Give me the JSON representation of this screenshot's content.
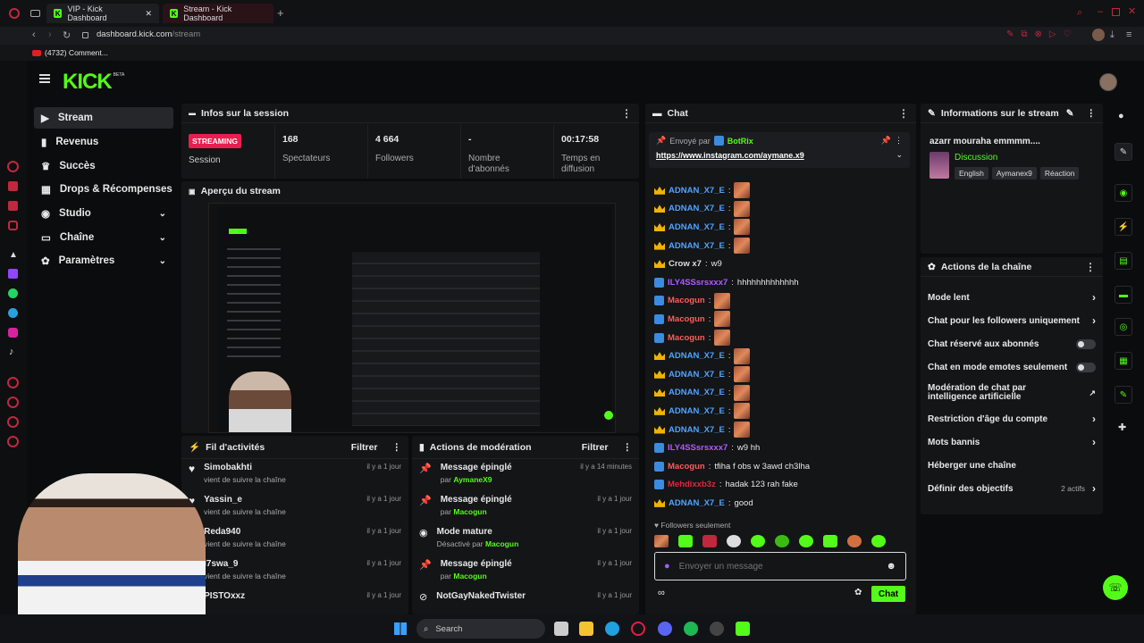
{
  "browser": {
    "tabs": [
      {
        "title": "VIP - Kick Dashboard"
      },
      {
        "title": "Stream - Kick Dashboard"
      }
    ],
    "url_host": "dashboard.kick.com",
    "url_path": "/stream",
    "bookmark": "(4732) Comment...",
    "search_placeholder": "Search"
  },
  "header": {
    "logo": "KICK",
    "beta": "BETA"
  },
  "sidebar": {
    "items": [
      {
        "label": "Stream",
        "icon": "video-icon"
      },
      {
        "label": "Revenus",
        "icon": "chart-icon"
      },
      {
        "label": "Succès",
        "icon": "trophy-icon"
      },
      {
        "label": "Drops & Récompenses",
        "icon": "gift-icon"
      },
      {
        "label": "Studio",
        "icon": "studio-icon"
      },
      {
        "label": "Chaîne",
        "icon": "tv-icon"
      },
      {
        "label": "Paramètres",
        "icon": "gear-icon"
      }
    ]
  },
  "session": {
    "title": "Infos sur la session",
    "status": "STREAMING",
    "status_label": "Session",
    "stats": [
      {
        "value": "168",
        "label": "Spectateurs"
      },
      {
        "value": "4 664",
        "label": "Followers"
      },
      {
        "value": "-",
        "label": "Nombre d'abonnés"
      },
      {
        "value": "00:17:58",
        "label": "Temps en diffusion"
      }
    ]
  },
  "preview": {
    "title": "Aperçu du stream"
  },
  "activity": {
    "title": "Fil d'activités",
    "filter": "Filtrer",
    "items": [
      {
        "name": "Simobakhti",
        "sub": "vient de suivre la chaîne",
        "time": "il y a 1 jour"
      },
      {
        "name": "Yassin_e",
        "sub": "vient de suivre la chaîne",
        "time": "il y a 1 jour"
      },
      {
        "name": "Reda940",
        "sub": "vient de suivre la chaîne",
        "time": "il y a 1 jour"
      },
      {
        "name": "l7swa_9",
        "sub": "vient de suivre la chaîne",
        "time": "il y a 1 jour"
      },
      {
        "name": "PISTOxxz",
        "sub": "",
        "time": "il y a 1 jour"
      }
    ]
  },
  "moderation": {
    "title": "Actions de modération",
    "filter": "Filtrer",
    "items": [
      {
        "action": "Message épinglé",
        "by": "par",
        "user": "AymaneX9",
        "time": "il y a 14 minutes"
      },
      {
        "action": "Message épinglé",
        "by": "par",
        "user": "Macogun",
        "time": "il y a 1 jour"
      },
      {
        "action": "Mode mature",
        "by": "Désactivé par",
        "user": "Macogun",
        "time": "il y a 1 jour"
      },
      {
        "action": "Message épinglé",
        "by": "par",
        "user": "Macogun",
        "time": "il y a 1 jour"
      },
      {
        "action": "NotGayNakedTwister",
        "by": "",
        "user": "",
        "time": "il y a 1 jour"
      }
    ]
  },
  "chat": {
    "title": "Chat",
    "pinned_by": "Envoyé par",
    "pinned_user": "BotRix",
    "pinned_link": "https://www.instagram.com/aymane.x9",
    "messages": [
      {
        "user": "ADNAN_X7_E",
        "text": "",
        "color": "#4fa3ff",
        "emote": true
      },
      {
        "user": "ADNAN_X7_E",
        "text": "",
        "color": "#4fa3ff",
        "emote": true
      },
      {
        "user": "ADNAN_X7_E",
        "text": "",
        "color": "#4fa3ff",
        "emote": true
      },
      {
        "user": "ADNAN_X7_E",
        "text": "",
        "color": "#4fa3ff",
        "emote": true
      },
      {
        "user": "Crow x7",
        "text": "w9",
        "color": "#dddddd",
        "emote": false
      },
      {
        "user": "ILY4SSsrsxxx7",
        "text": "hhhhhhhhhhhhh",
        "color": "#b05bff",
        "emote": false
      },
      {
        "user": "Macogun",
        "text": "",
        "color": "#ff5b5b",
        "emote": true
      },
      {
        "user": "Macogun",
        "text": "",
        "color": "#ff5b5b",
        "emote": true
      },
      {
        "user": "Macogun",
        "text": "",
        "color": "#ff5b5b",
        "emote": true
      },
      {
        "user": "ADNAN_X7_E",
        "text": "",
        "color": "#4fa3ff",
        "emote": true
      },
      {
        "user": "ADNAN_X7_E",
        "text": "",
        "color": "#4fa3ff",
        "emote": true
      },
      {
        "user": "ADNAN_X7_E",
        "text": "",
        "color": "#4fa3ff",
        "emote": true
      },
      {
        "user": "ADNAN_X7_E",
        "text": "",
        "color": "#4fa3ff",
        "emote": true
      },
      {
        "user": "ADNAN_X7_E",
        "text": "",
        "color": "#4fa3ff",
        "emote": true
      },
      {
        "user": "ILY4SSsrsxxx7",
        "text": "w9 hh",
        "color": "#b05bff",
        "emote": false
      },
      {
        "user": "Macogun",
        "text": "tfiha f obs w 3awd ch3lha",
        "color": "#ff5b5b",
        "emote": false
      },
      {
        "user": "Mehdixxb3z",
        "text": "hadak 123 rah fake",
        "color": "#e0283e",
        "emote": false
      },
      {
        "user": "ADNAN_X7_E",
        "text": "good",
        "color": "#4fa3ff",
        "emote": false
      }
    ],
    "followers_only": "Followers seulement",
    "input_placeholder": "Envoyer un message",
    "send": "Chat"
  },
  "stream_info": {
    "title": "Informations sur le stream",
    "stream_title": "azarr mouraha emmmm....",
    "category": "Discussion",
    "tags": [
      "English",
      "Aymanex9",
      "Réaction"
    ]
  },
  "channel_actions": {
    "title": "Actions de la chaîne",
    "items": [
      {
        "label": "Mode lent",
        "kind": "arrow"
      },
      {
        "label": "Chat pour les followers uniquement",
        "kind": "arrow"
      },
      {
        "label": "Chat réservé aux abonnés",
        "kind": "toggle"
      },
      {
        "label": "Chat en mode emotes seulement",
        "kind": "toggle"
      },
      {
        "label": "Modération de chat par intelligence artificielle",
        "kind": "ext"
      },
      {
        "label": "Restriction d'âge du compte",
        "kind": "arrow"
      },
      {
        "label": "Mots bannis",
        "kind": "arrow"
      },
      {
        "label": "Héberger une chaîne",
        "kind": "none"
      },
      {
        "label": "Définir des objectifs",
        "kind": "arrow"
      }
    ],
    "goals_count": "2 actifs"
  },
  "colors": {
    "accent": "#53fc18",
    "live": "#e91e50",
    "bg": "#0b0c0d",
    "panel": "#141517"
  }
}
